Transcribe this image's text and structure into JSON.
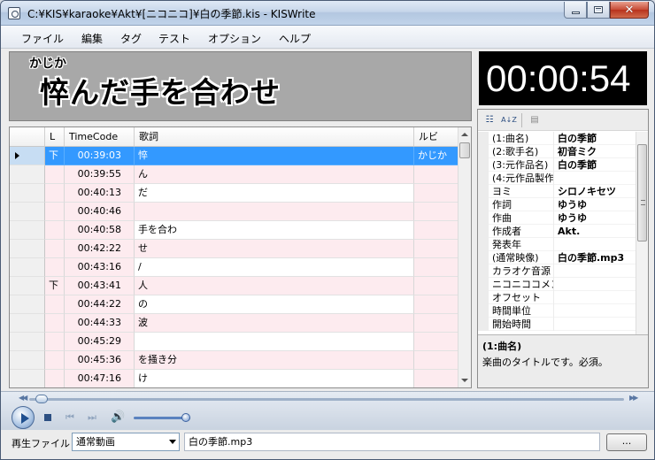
{
  "window": {
    "title": "C:¥KIS¥karaoke¥Akt¥[ニコニコ]¥白の季節.kis - KISWrite",
    "minimize": "_",
    "close": "✕"
  },
  "menu": [
    "ファイル",
    "編集",
    "タグ",
    "テスト",
    "オプション",
    "ヘルプ"
  ],
  "lyric_display": {
    "ruby": "かじか",
    "text": "悴んだ手を合わせ"
  },
  "time_display": "00:00:54",
  "grid": {
    "columns": [
      "L",
      "TimeCode",
      "歌詞",
      "ルビ"
    ],
    "rows": [
      {
        "l": "下",
        "tc": "00:39:03",
        "lyric": "悴",
        "ruby": "かじか",
        "selected": true
      },
      {
        "l": "",
        "tc": "00:39:55",
        "lyric": "ん",
        "ruby": ""
      },
      {
        "l": "",
        "tc": "00:40:13",
        "lyric": "だ",
        "ruby": ""
      },
      {
        "l": "",
        "tc": "00:40:46",
        "lyric": "",
        "ruby": ""
      },
      {
        "l": "",
        "tc": "00:40:58",
        "lyric": "手を合わ",
        "ruby": ""
      },
      {
        "l": "",
        "tc": "00:42:22",
        "lyric": "せ",
        "ruby": ""
      },
      {
        "l": "",
        "tc": "00:43:16",
        "lyric": "/",
        "ruby": ""
      },
      {
        "l": "下",
        "tc": "00:43:41",
        "lyric": "人",
        "ruby": ""
      },
      {
        "l": "",
        "tc": "00:44:22",
        "lyric": "の",
        "ruby": ""
      },
      {
        "l": "",
        "tc": "00:44:33",
        "lyric": "波",
        "ruby": ""
      },
      {
        "l": "",
        "tc": "00:45:29",
        "lyric": "",
        "ruby": ""
      },
      {
        "l": "",
        "tc": "00:45:36",
        "lyric": "を掻き分",
        "ruby": ""
      },
      {
        "l": "",
        "tc": "00:47:16",
        "lyric": "け",
        "ruby": ""
      }
    ]
  },
  "properties": {
    "toolbar": {
      "sort_alpha": "A↓Z"
    },
    "items": [
      {
        "name": "(1:曲名)",
        "value": "白の季節"
      },
      {
        "name": "(2:歌手名)",
        "value": "初音ミク"
      },
      {
        "name": "(3:元作品名)",
        "value": "白の季節"
      },
      {
        "name": "(4:元作品製作",
        "value": ""
      },
      {
        "name": "ヨミ",
        "value": "シロノキセツ"
      },
      {
        "name": "作詞",
        "value": "ゆうゆ"
      },
      {
        "name": "作曲",
        "value": "ゆうゆ"
      },
      {
        "name": "作成者",
        "value": "Akt."
      },
      {
        "name": "発表年",
        "value": ""
      },
      {
        "name": "(通常映像)",
        "value": "白の季節.mp3"
      },
      {
        "name": "カラオケ音源",
        "value": ""
      },
      {
        "name": "ニコニココメント",
        "value": ""
      },
      {
        "name": "オフセット",
        "value": ""
      },
      {
        "name": "時間単位",
        "value": ""
      },
      {
        "name": "開始時間",
        "value": ""
      }
    ],
    "description": {
      "title": "(1:曲名)",
      "body": "楽曲のタイトルです。必須。"
    }
  },
  "player": {
    "seek_position": 0.01,
    "volume": 0.85
  },
  "bottom": {
    "file_label": "再生ファイル",
    "file_type": "通常動画",
    "file_path": "白の季節.mp3",
    "browse_label": "..."
  }
}
